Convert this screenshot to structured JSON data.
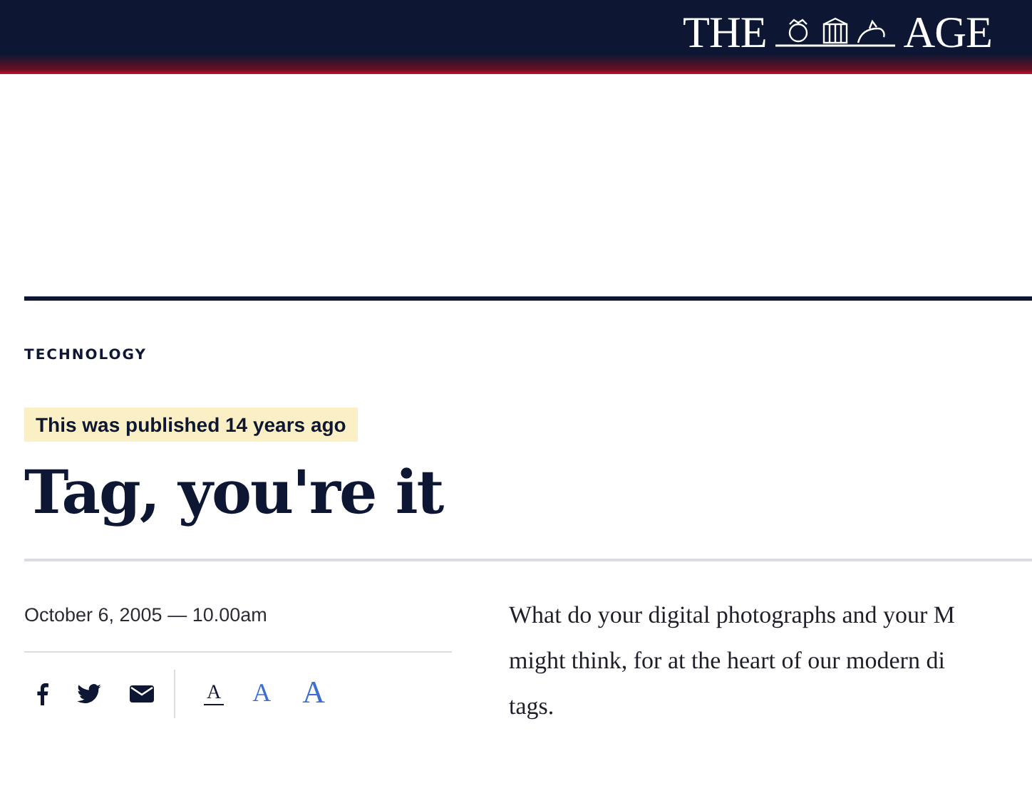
{
  "masthead": {
    "logo_left": "THE",
    "logo_right": "AGE"
  },
  "article": {
    "section": "TECHNOLOGY",
    "age_notice": "This was published 14 years ago",
    "title": "Tag, you're it",
    "dateline": "October 6, 2005 — 10.00am",
    "text_sizes": [
      {
        "label": "A",
        "selected": true
      },
      {
        "label": "A",
        "selected": false
      },
      {
        "label": "A",
        "selected": false
      }
    ],
    "body_lines": [
      "What do your digital photographs and your M",
      "might think, for at the heart of our modern di",
      "tags."
    ]
  }
}
